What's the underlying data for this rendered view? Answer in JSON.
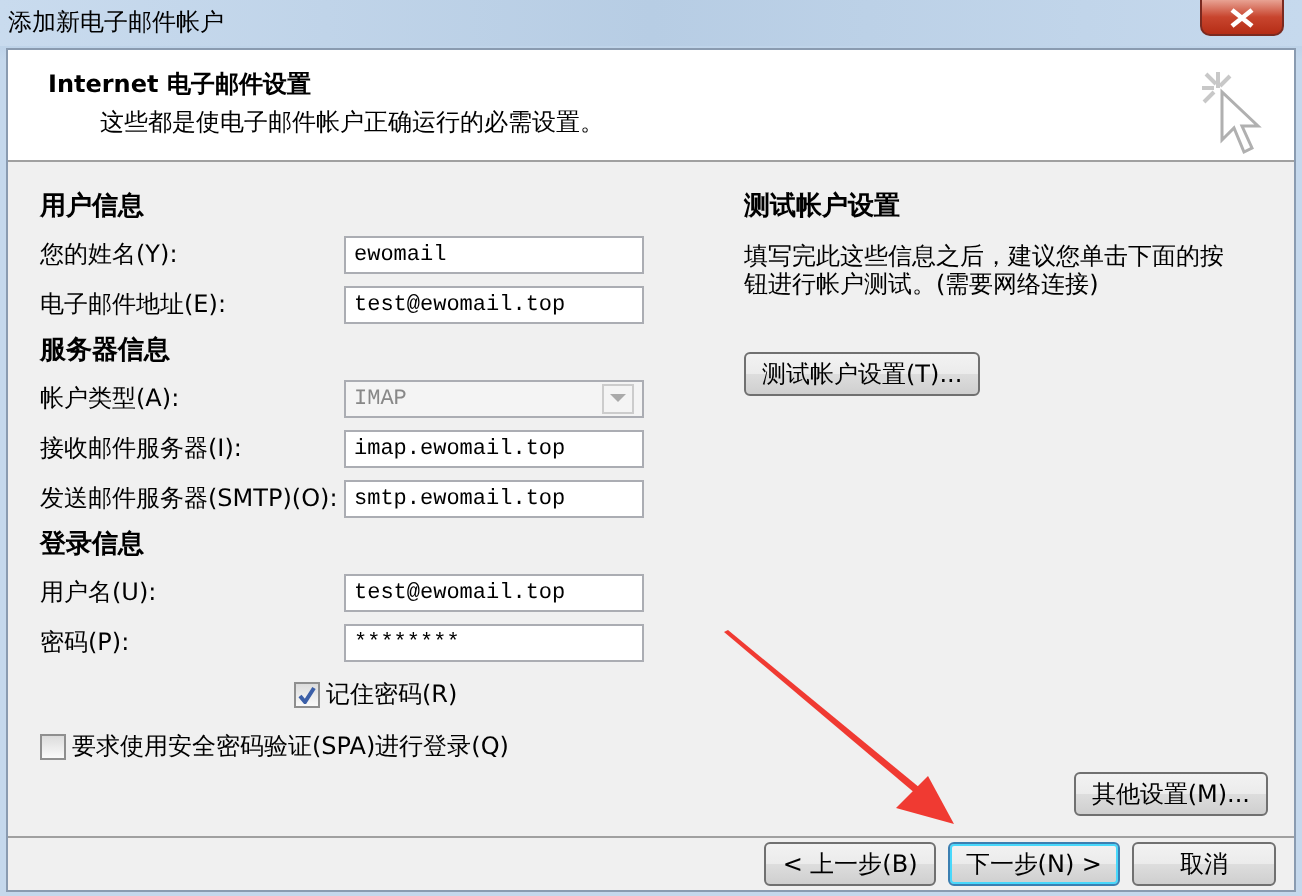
{
  "window": {
    "title": "添加新电子邮件帐户"
  },
  "header": {
    "title": "Internet 电子邮件设置",
    "subtitle": "这些都是使电子邮件帐户正确运行的必需设置。"
  },
  "sections": [
    {
      "heading": "用户信息",
      "fields": [
        {
          "label": "您的姓名(Y):",
          "value": "ewomail",
          "kind": "text",
          "disabled": false
        },
        {
          "label": "电子邮件地址(E):",
          "value": "test@ewomail.top",
          "kind": "text",
          "disabled": false
        }
      ]
    },
    {
      "heading": "服务器信息",
      "fields": [
        {
          "label": "帐户类型(A):",
          "value": "IMAP",
          "kind": "dropdown",
          "disabled": true
        },
        {
          "label": "接收邮件服务器(I):",
          "value": "imap.ewomail.top",
          "kind": "text",
          "disabled": false
        },
        {
          "label": "发送邮件服务器(SMTP)(O):",
          "value": "smtp.ewomail.top",
          "kind": "text",
          "disabled": false
        }
      ]
    },
    {
      "heading": "登录信息",
      "fields": [
        {
          "label": "用户名(U):",
          "value": "test@ewomail.top",
          "kind": "text",
          "disabled": false
        },
        {
          "label": "密码(P):",
          "value": "********",
          "kind": "text",
          "disabled": false
        }
      ]
    }
  ],
  "options": [
    {
      "label": "记住密码(R)",
      "checked": true,
      "kind": "indented"
    },
    {
      "label": "要求使用安全密码验证(SPA)进行登录(Q)",
      "checked": false,
      "kind": "plain"
    }
  ],
  "test": {
    "heading": "测试帐户设置",
    "description": "填写完此这些信息之后，建议您单击下面的按钮进行帐户测试。(需要网络连接)",
    "button": "测试帐户设置(T)..."
  },
  "more_button": "其他设置(M)...",
  "nav_buttons": [
    {
      "label": "< 上一步(B)",
      "default": false
    },
    {
      "label": "下一步(N) >",
      "default": true
    },
    {
      "label": "取消",
      "default": false
    }
  ]
}
